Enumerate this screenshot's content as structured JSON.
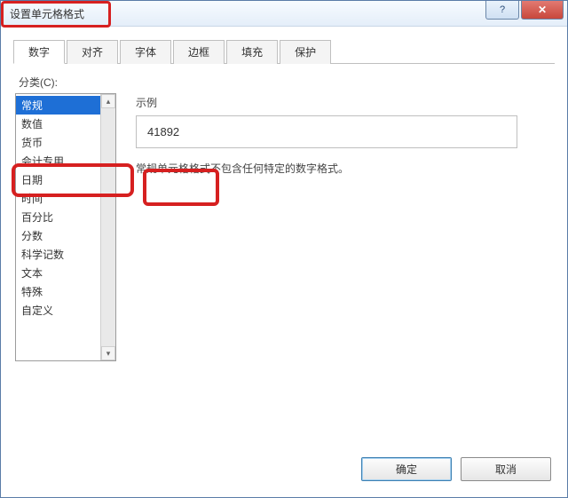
{
  "window": {
    "title": "设置单元格格式"
  },
  "tabs": [
    "数字",
    "对齐",
    "字体",
    "边框",
    "填充",
    "保护"
  ],
  "active_tab_index": 0,
  "category_label": "分类(C):",
  "categories": [
    "常规",
    "数值",
    "货币",
    "会计专用",
    "日期",
    "时间",
    "百分比",
    "分数",
    "科学记数",
    "文本",
    "特殊",
    "自定义"
  ],
  "selected_category_index": 0,
  "preview": {
    "label": "示例",
    "value": "41892"
  },
  "description": "常规单元格格式不包含任何特定的数字格式。",
  "buttons": {
    "ok": "确定",
    "cancel": "取消"
  },
  "win_buttons": {
    "help": "?",
    "close": "✕"
  }
}
